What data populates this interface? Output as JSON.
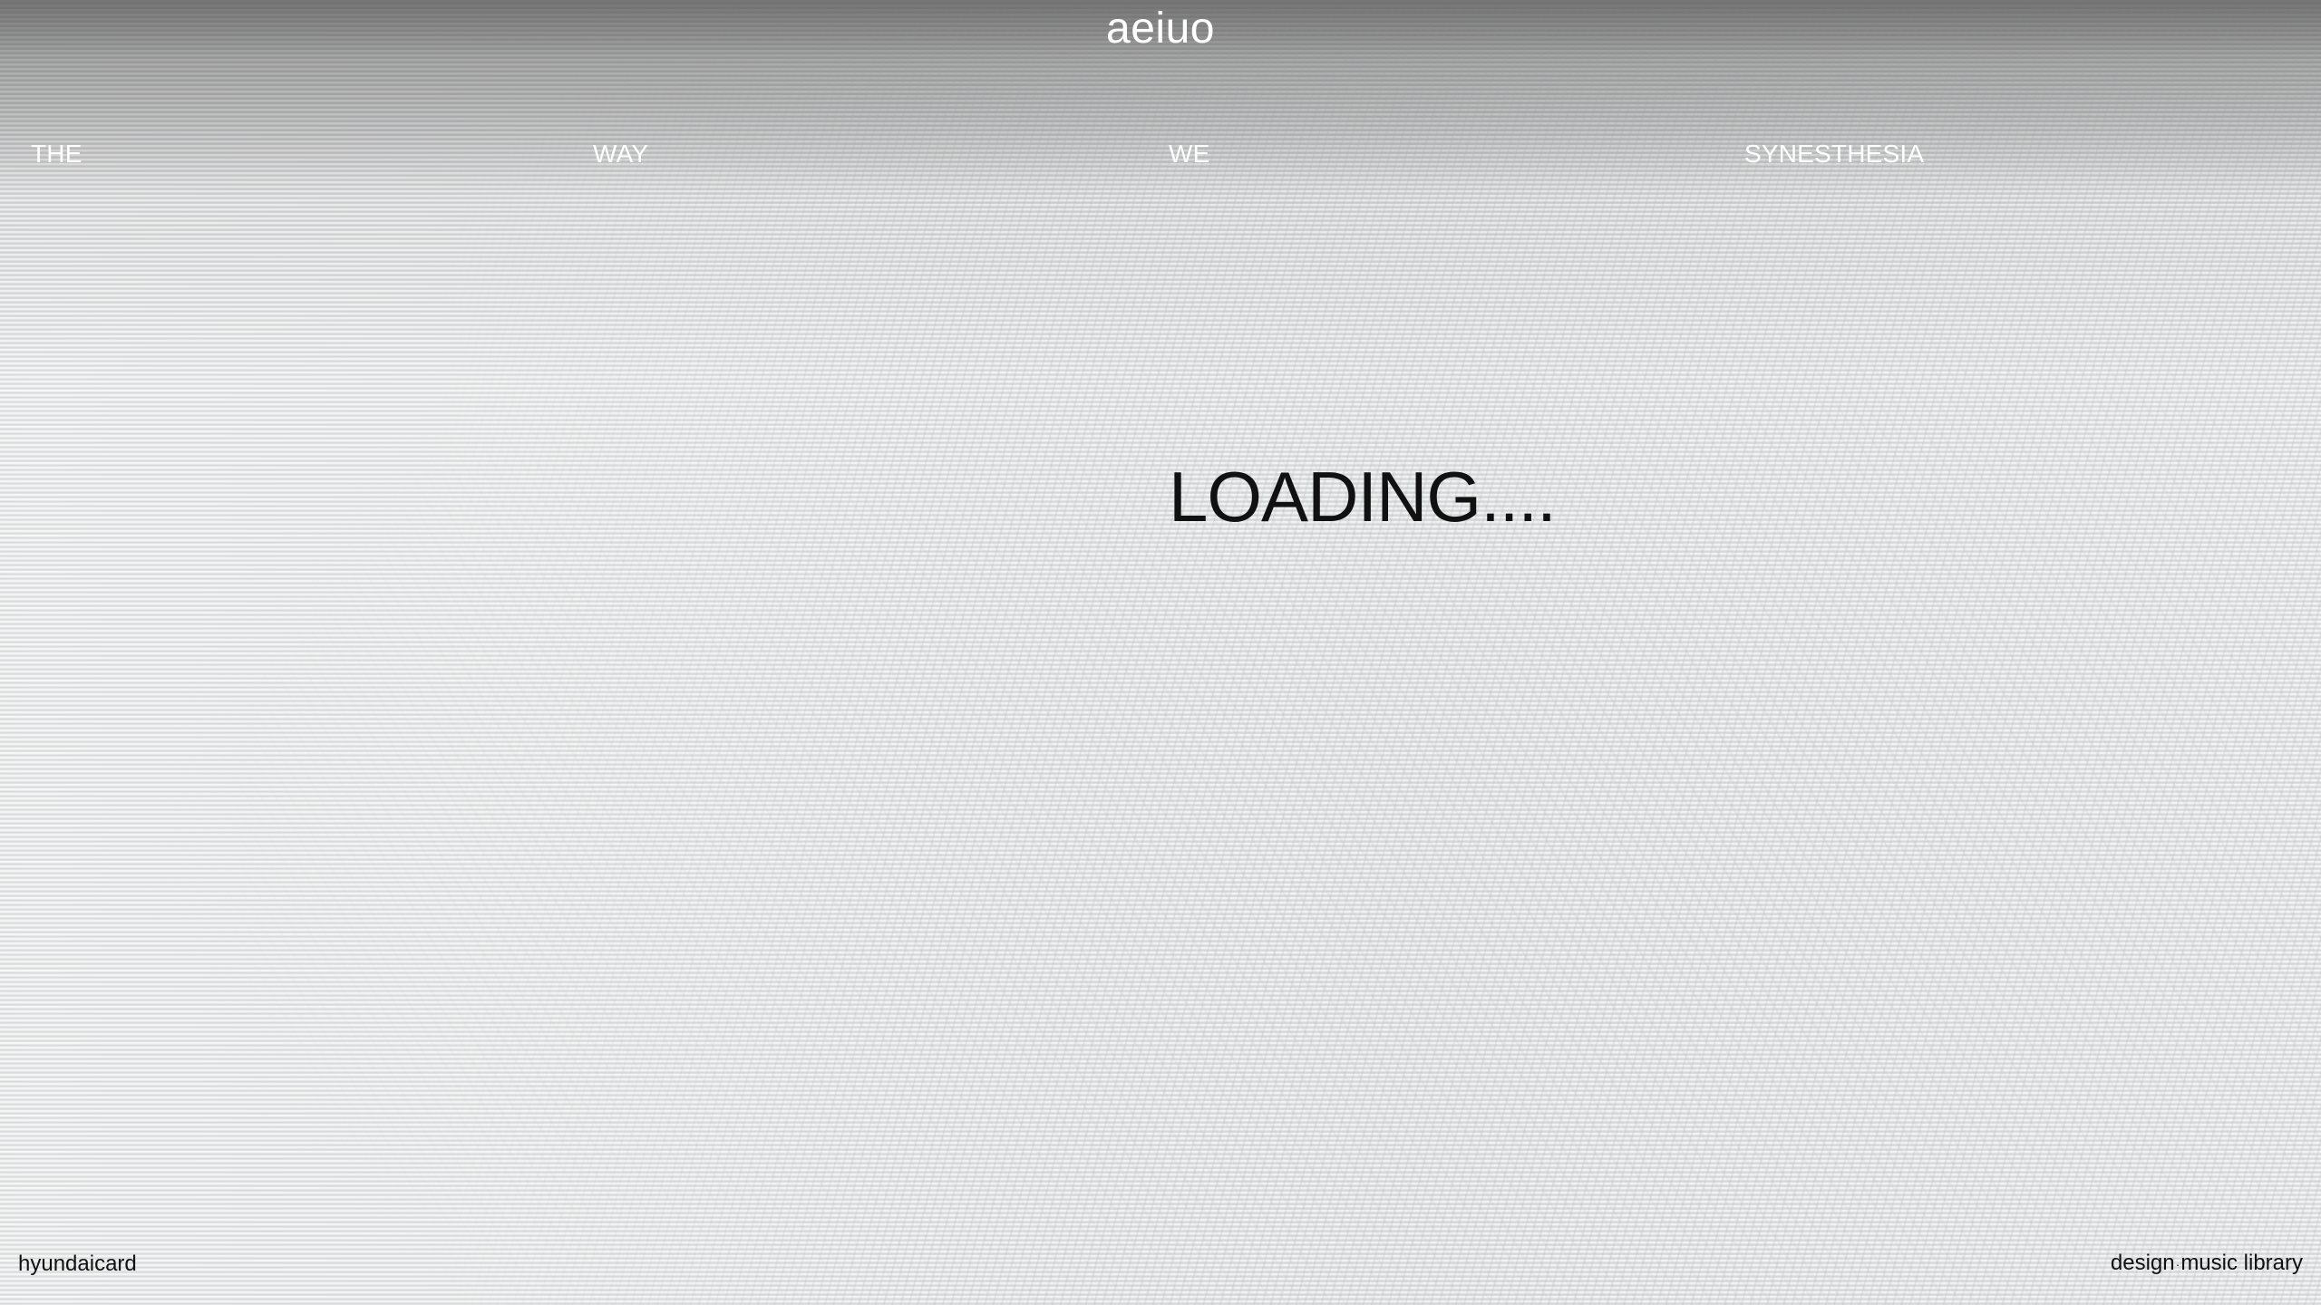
{
  "header": {
    "logo": "aeiuo"
  },
  "tagline": {
    "words": [
      "THE",
      "WAY",
      "WE",
      "SYNESTHESIA"
    ]
  },
  "main": {
    "status": "LOADING...."
  },
  "footer": {
    "left_label": "hyundaicard",
    "right_part1": "design",
    "separator": "·",
    "right_part2": "music library"
  },
  "colors": {
    "text_light": "#ffffff",
    "text_dark": "#111111",
    "background": "#e6e6e6"
  }
}
